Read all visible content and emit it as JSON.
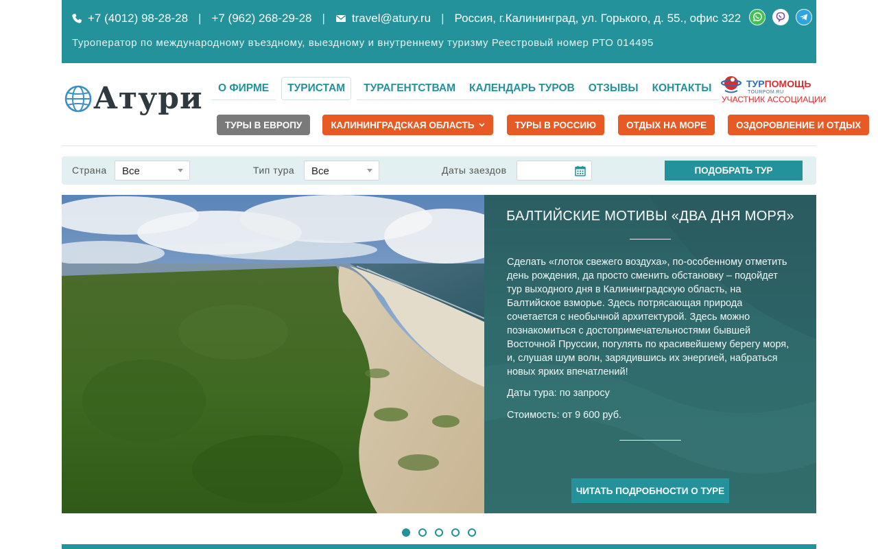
{
  "topbar": {
    "phone1": "+7 (4012) 98-28-28",
    "phone2": "+7 (962) 268-29-28",
    "email": "travel@atury.ru",
    "address": "Россия, г.Калининград, ул. Горького, д. 55., офис 322",
    "separator": "|",
    "tagline": "Туроператор по международному въездному, выездному и внутреннему туризму Реестровый номер РТО 014495",
    "social": [
      "whatsapp-icon",
      "viber-icon",
      "telegram-icon"
    ]
  },
  "logo": {
    "text": "Атури"
  },
  "nav": {
    "main": [
      "О ФИРМЕ",
      "ТУРИСТАМ",
      "ТУРАГЕНТСТВАМ",
      "КАЛЕНДАРЬ ТУРОВ",
      "ОТЗЫВЫ",
      "КОНТАКТЫ"
    ],
    "active": "ТУРИСТАМ",
    "tours": [
      {
        "label": "ТУРЫ В ЕВРОПУ",
        "style": "grey"
      },
      {
        "label": "КАЛИНИНГРАДСКАЯ ОБЛАСТЬ",
        "style": "orange",
        "dropdown": true
      },
      {
        "label": "ТУРЫ В РОССИЮ",
        "style": "orange"
      },
      {
        "label": "ОТДЫХ НА МОРЕ",
        "style": "orange"
      },
      {
        "label": "ОЗДОРОВЛЕНИЕ И ОТДЫХ",
        "style": "orange"
      }
    ]
  },
  "partner": {
    "brand_part1": "ТУР",
    "brand_part2": "ПОМОЩЬ",
    "site": "TOURPOM.RU",
    "caption": "УЧАСТНИК АССОЦИАЦИИ"
  },
  "filter": {
    "country_label": "Страна",
    "country_value": "Все",
    "type_label": "Тип тура",
    "type_value": "Все",
    "dates_label": "Даты заездов",
    "dates_value": "",
    "submit": "ПОДОБРАТЬ ТУР"
  },
  "slide": {
    "title": "БАЛТИЙСКИЕ МОТИВЫ «ДВА ДНЯ МОРЯ»",
    "description": "Сделать «глоток свежего воздуха», по-особенному отметить день рождения, да просто сменить обстановку – подойдет тур выходного дня в Калининградскую область, на Балтийское взморье. Здесь потрясающая природа сочетается с необычной архитектурой. Здесь можно познакомиться с достопримечательностями бывшей Восточной Пруссии, погулять по красивейшему берегу моря, и, слушая шум волн, зарядившись их энергией, набраться новых ярких впечатлений!",
    "dates": "Даты тура:  по запросу",
    "price": "Стоимость: от 9 600 руб.",
    "button": "ЧИТАТЬ ПОДРОБНОСТИ О ТУРЕ"
  },
  "slider": {
    "count": 5,
    "active_index": 0
  },
  "colors": {
    "primary": "#23929a",
    "accent": "#e85a25",
    "grey": "#7a7a7a"
  }
}
